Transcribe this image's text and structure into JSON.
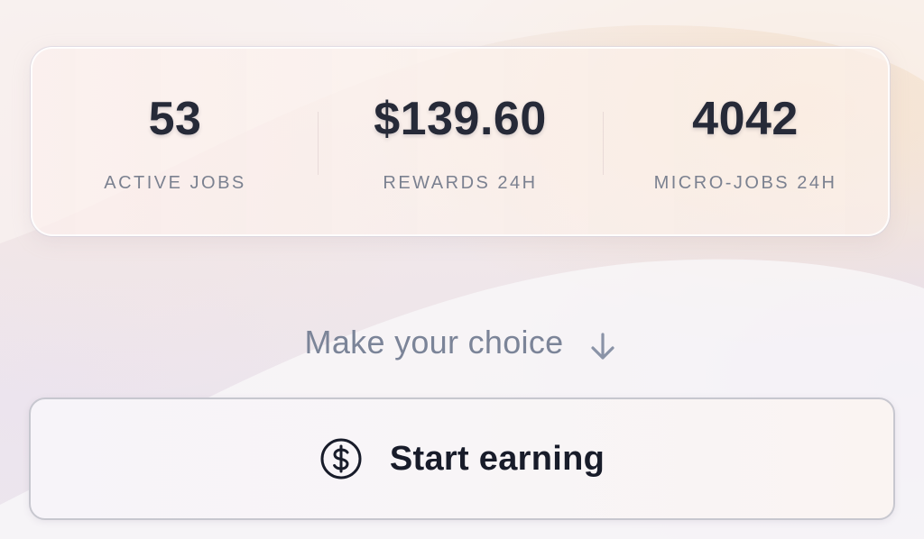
{
  "stats": [
    {
      "value": "53",
      "label": "ACTIVE JOBS"
    },
    {
      "value": "$139.60",
      "label": "REWARDS 24H"
    },
    {
      "value": "4042",
      "label": "MICRO-JOBS 24H"
    }
  ],
  "choice": {
    "text": "Make your choice",
    "icon": "arrow-down-icon"
  },
  "start_button": {
    "label": "Start earning",
    "icon": "dollar-circle-icon"
  },
  "colors": {
    "value_text": "#262a38",
    "label_text": "#7b8190",
    "choice_text": "#7b8498",
    "button_text": "#181c2a"
  }
}
